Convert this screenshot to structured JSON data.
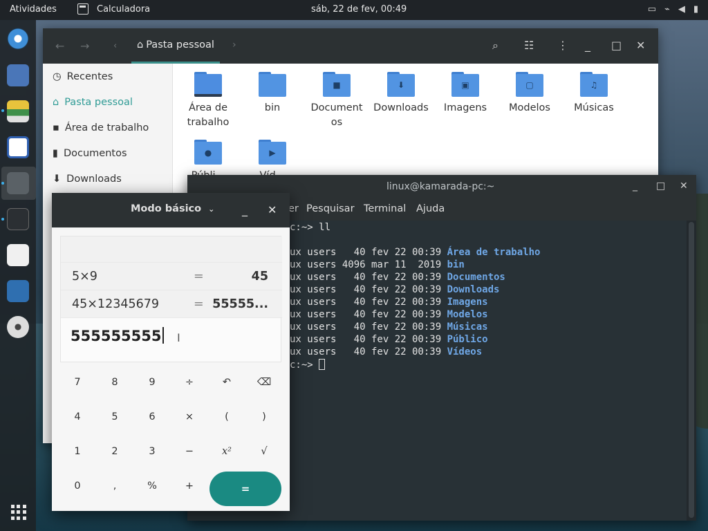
{
  "topbar": {
    "activities": "Atividades",
    "app_name": "Calculadora",
    "clock": "sáb, 22 de fev, 00:49"
  },
  "file_manager": {
    "path_label": "Pasta pessoal",
    "sidebar": [
      "Recentes",
      "Pasta pessoal",
      "Área de trabalho",
      "Documentos",
      "Downloads"
    ],
    "folders": [
      {
        "name": "Área de\ntrabalho",
        "glyph": ""
      },
      {
        "name": "bin",
        "glyph": ""
      },
      {
        "name": "Document\nos",
        "glyph": "■"
      },
      {
        "name": "Downloads",
        "glyph": "⬇"
      },
      {
        "name": "Imagens",
        "glyph": "▣"
      },
      {
        "name": "Modelos",
        "glyph": "▢"
      },
      {
        "name": "Músicas",
        "glyph": "♫"
      },
      {
        "name": "Públi...",
        "glyph": "●"
      },
      {
        "name": "Víd...",
        "glyph": "▶"
      }
    ]
  },
  "terminal": {
    "title": "linux@kamarada-pc:~",
    "menu": [
      "er",
      "Pesquisar",
      "Terminal",
      "Ajuda"
    ],
    "prompt_line": "c:~> ll",
    "rows": [
      {
        "meta": "ux users   40 fev 22 00:39 ",
        "name": "Área de trabalho"
      },
      {
        "meta": "ux users 4096 mar 11  2019 ",
        "name": "bin"
      },
      {
        "meta": "ux users   40 fev 22 00:39 ",
        "name": "Documentos"
      },
      {
        "meta": "ux users   40 fev 22 00:39 ",
        "name": "Downloads"
      },
      {
        "meta": "ux users   40 fev 22 00:39 ",
        "name": "Imagens"
      },
      {
        "meta": "ux users   40 fev 22 00:39 ",
        "name": "Modelos"
      },
      {
        "meta": "ux users   40 fev 22 00:39 ",
        "name": "Músicas"
      },
      {
        "meta": "ux users   40 fev 22 00:39 ",
        "name": "Público"
      },
      {
        "meta": "ux users   40 fev 22 00:39 ",
        "name": "Vídeos"
      }
    ],
    "final_prompt": "c:~> "
  },
  "calculator": {
    "mode": "Modo básico",
    "history": [
      {
        "expr": "5×9",
        "eq": "=",
        "result": "45"
      },
      {
        "expr": "45×12345679",
        "eq": "=",
        "result": "55555..."
      }
    ],
    "input": "555555555",
    "keys": [
      [
        "7",
        "8",
        "9",
        "÷",
        "↶",
        "⌫"
      ],
      [
        "4",
        "5",
        "6",
        "×",
        "(",
        ")"
      ],
      [
        "1",
        "2",
        "3",
        "−",
        "x²",
        "√"
      ],
      [
        "0",
        ",",
        "%",
        "+"
      ]
    ],
    "equals": "=",
    "accent": "#1a8a82"
  }
}
